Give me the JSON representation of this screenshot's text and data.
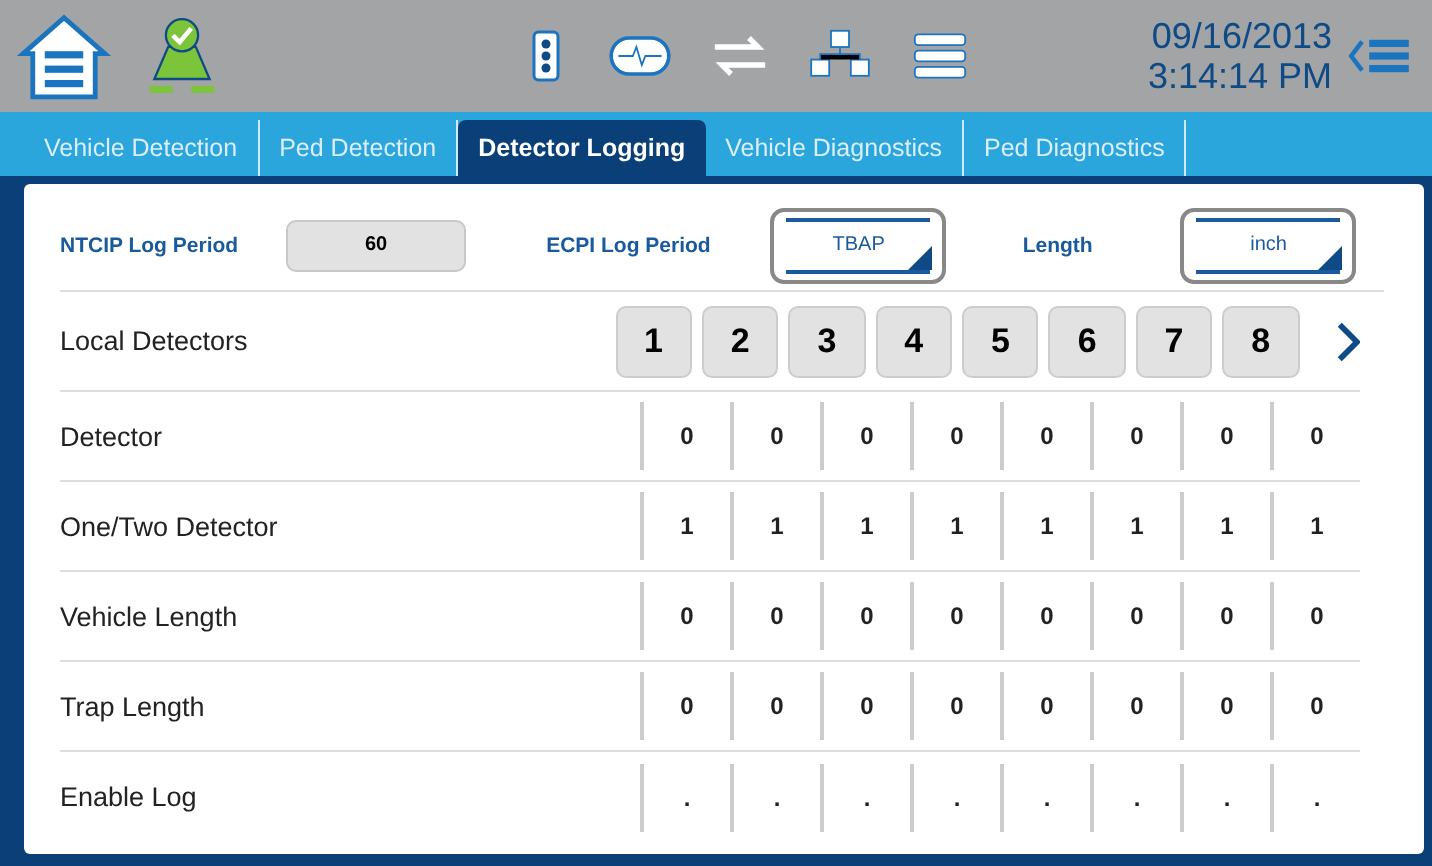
{
  "header": {
    "date": "09/16/2013",
    "time": "3:14:14 PM"
  },
  "tabs": [
    {
      "label": "Vehicle Detection",
      "selected": false
    },
    {
      "label": "Ped Detection",
      "selected": false
    },
    {
      "label": "Detector Logging",
      "selected": true
    },
    {
      "label": "Vehicle Diagnostics",
      "selected": false
    },
    {
      "label": "Ped Diagnostics",
      "selected": false
    }
  ],
  "settings": [
    {
      "kind": "field",
      "label": "NTCIP Log Period",
      "value": "60"
    },
    {
      "kind": "dropdown",
      "label": "ECPI Log Period",
      "value": "TBAP"
    },
    {
      "kind": "dropdown",
      "label": "Length",
      "value": "inch"
    }
  ],
  "table": {
    "header_label": "Local Detectors",
    "columns": [
      "1",
      "2",
      "3",
      "4",
      "5",
      "6",
      "7",
      "8"
    ],
    "rows": [
      {
        "label": "Detector",
        "cells": [
          "0",
          "0",
          "0",
          "0",
          "0",
          "0",
          "0",
          "0"
        ]
      },
      {
        "label": "One/Two Detector",
        "cells": [
          "1",
          "1",
          "1",
          "1",
          "1",
          "1",
          "1",
          "1"
        ]
      },
      {
        "label": "Vehicle Length",
        "cells": [
          "0",
          "0",
          "0",
          "0",
          "0",
          "0",
          "0",
          "0"
        ]
      },
      {
        "label": "Trap Length",
        "cells": [
          "0",
          "0",
          "0",
          "0",
          "0",
          "0",
          "0",
          "0"
        ]
      },
      {
        "label": "Enable Log",
        "cells": [
          ".",
          ".",
          ".",
          ".",
          ".",
          ".",
          ".",
          "."
        ]
      }
    ]
  }
}
